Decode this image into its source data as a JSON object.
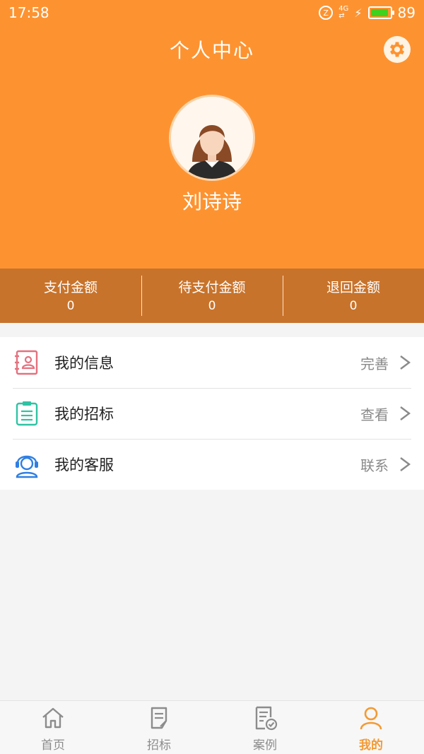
{
  "status_bar": {
    "time": "17:58",
    "network": "4G",
    "battery": "89"
  },
  "header": {
    "title": "个人中心",
    "username": "刘诗诗"
  },
  "stats": [
    {
      "label": "支付金额",
      "value": "0"
    },
    {
      "label": "待支付金额",
      "value": "0"
    },
    {
      "label": "退回金额",
      "value": "0"
    }
  ],
  "menu": [
    {
      "label": "我的信息",
      "action": "完善",
      "icon": "contact-book-icon",
      "color": "#e4717e"
    },
    {
      "label": "我的招标",
      "action": "查看",
      "icon": "clipboard-list-icon",
      "color": "#2fc3a3"
    },
    {
      "label": "我的客服",
      "action": "联系",
      "icon": "headset-user-icon",
      "color": "#2f7fe2"
    }
  ],
  "tabs": [
    {
      "label": "首页",
      "icon": "home-icon",
      "active": false
    },
    {
      "label": "招标",
      "icon": "document-edit-icon",
      "active": false
    },
    {
      "label": "案例",
      "icon": "document-check-icon",
      "active": false
    },
    {
      "label": "我的",
      "icon": "user-icon",
      "active": true
    }
  ],
  "colors": {
    "header": "#fd9330",
    "stats_bar": "#c8732b",
    "active_tab": "#f39a34"
  }
}
